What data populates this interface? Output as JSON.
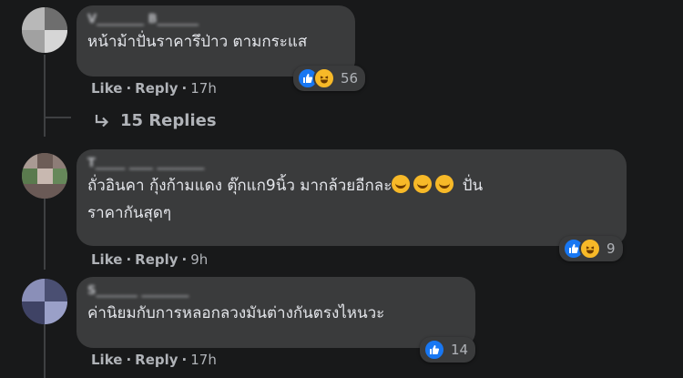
{
  "comments": [
    {
      "author": "V________ B_______",
      "text": "หน้าม้าปั่นราคารึป่าว ตามกระแส",
      "reactions": [
        "like",
        "haha"
      ],
      "reaction_count": "56",
      "like_label": "Like",
      "reply_label": "Reply",
      "time": "17h"
    },
    {
      "author": "T_____ ____ ________",
      "text_line1": "ถั่วอินคา กุ้งก้ามแดง ตุ๊กแก9นิ้ว มากล้วยอีกละ",
      "text_line1_tail": "ปั่น",
      "text_line2": "ราคากันสุดๆ",
      "reactions": [
        "like",
        "haha"
      ],
      "reaction_count": "9",
      "like_label": "Like",
      "reply_label": "Reply",
      "time": "9h"
    },
    {
      "author": "S_______ ________",
      "text": "ค่านิยมกับการหลอกลวงมันต่างกันตรงไหนวะ",
      "reactions": [
        "like"
      ],
      "reaction_count": "14",
      "like_label": "Like",
      "reply_label": "Reply",
      "time": "17h"
    }
  ],
  "replies_link": "15 Replies",
  "separator": "·",
  "colors": {
    "background": "#18191a",
    "bubble": "#3a3b3c",
    "text": "#e4e6eb",
    "secondary": "#b0b3b8",
    "like_blue": "#1877f2",
    "haha_yellow": "#f7b928"
  }
}
